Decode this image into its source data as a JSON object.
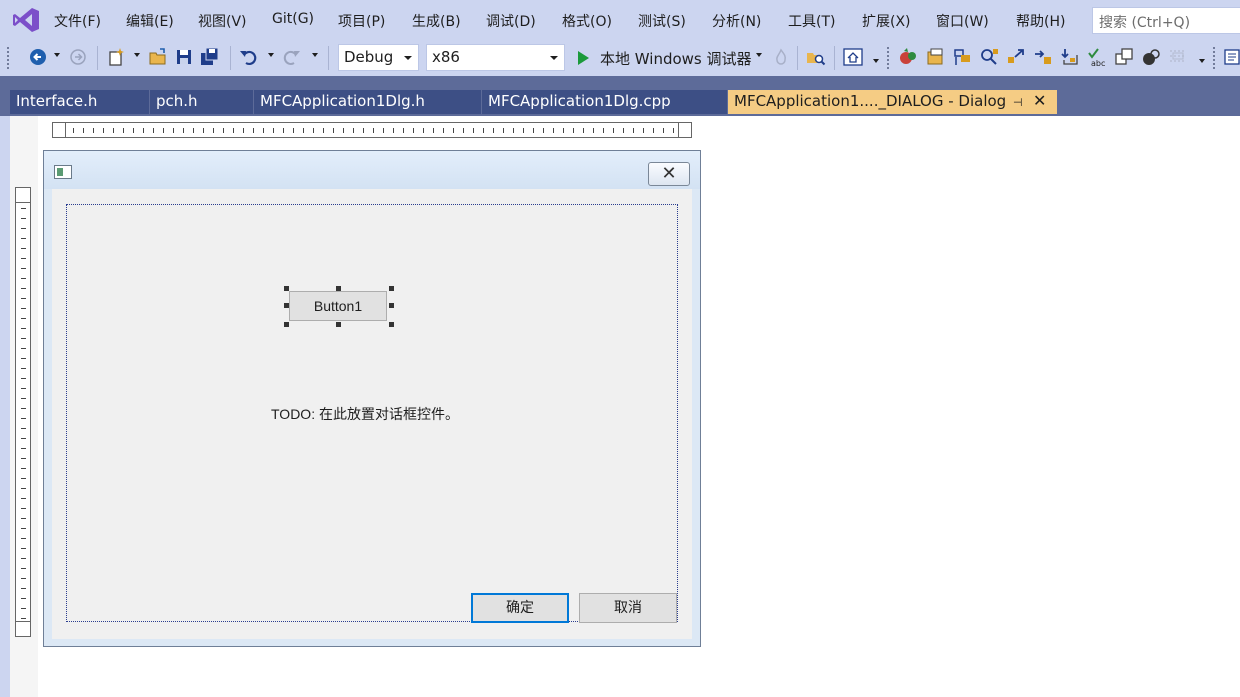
{
  "menu": {
    "file": "文件(F)",
    "edit": "编辑(E)",
    "view": "视图(V)",
    "git": "Git(G)",
    "project": "项目(P)",
    "build": "生成(B)",
    "debug": "调试(D)",
    "format": "格式(O)",
    "test": "测试(S)",
    "analyze": "分析(N)",
    "tools": "工具(T)",
    "extensions": "扩展(X)",
    "window": "窗口(W)",
    "help": "帮助(H)"
  },
  "search": {
    "placeholder": "搜索 (Ctrl+Q)"
  },
  "toolbar": {
    "config": "Debug",
    "platform": "x86",
    "start_label": "本地 Windows 调试器"
  },
  "tabs": [
    {
      "label": "Interface.h"
    },
    {
      "label": "pch.h"
    },
    {
      "label": "MFCApplication1Dlg.h"
    },
    {
      "label": "MFCApplication1Dlg.cpp"
    },
    {
      "label": "MFCApplication1...._DIALOG - Dialog"
    }
  ],
  "tab_controls": {
    "pin": "⊣",
    "close": "✕"
  },
  "dialog": {
    "close_glyph": "✕",
    "button1": "Button1",
    "todo": "TODO: 在此放置对话框控件。",
    "ok": "确定",
    "cancel": "取消"
  },
  "colors": {
    "chrome": "#ccd5f0",
    "tab_band": "#5d6b99",
    "tab_inactive": "#3d4f85",
    "tab_active": "#f5cc84",
    "vs_purple": "#7b4fc9",
    "run_green": "#1b9a3b",
    "focus_blue": "#0078d7"
  }
}
